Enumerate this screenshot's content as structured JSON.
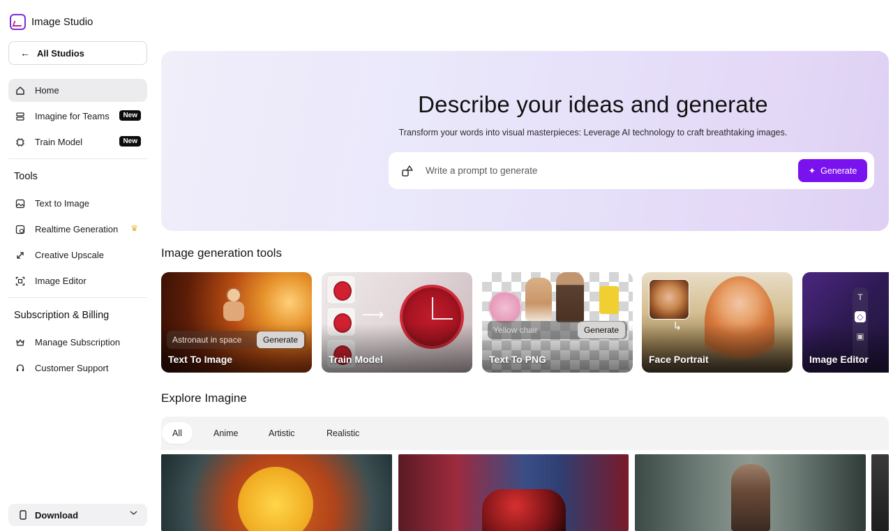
{
  "brand": {
    "name": "Image Studio",
    "icon": "image-studio-logo"
  },
  "sidebar": {
    "all_studios": "All Studios",
    "primary": [
      {
        "label": "Home",
        "icon": "home-icon",
        "active": true
      },
      {
        "label": "Imagine for Teams",
        "icon": "teams-icon",
        "badge": "New"
      },
      {
        "label": "Train Model",
        "icon": "chip-icon",
        "badge": "New"
      }
    ],
    "tools_title": "Tools",
    "tools": [
      {
        "label": "Text to Image",
        "icon": "image-icon"
      },
      {
        "label": "Realtime Generation",
        "icon": "realtime-icon",
        "premium_icon": "crown-icon"
      },
      {
        "label": "Creative Upscale",
        "icon": "expand-icon"
      },
      {
        "label": "Image Editor",
        "icon": "editor-icon"
      }
    ],
    "billing_title": "Subscription & Billing",
    "billing": [
      {
        "label": "Manage Subscription",
        "icon": "crown-outline-icon"
      },
      {
        "label": "Customer Support",
        "icon": "headset-icon"
      }
    ],
    "download": "Download"
  },
  "hero": {
    "title": "Describe your ideas and generate",
    "subtitle": "Transform your words into visual masterpieces: Leverage AI technology to craft breathtaking images.",
    "prompt_placeholder": "Write a prompt to generate",
    "generate_label": "Generate"
  },
  "tools_section": {
    "title": "Image generation tools",
    "cards": [
      {
        "label": "Text To Image",
        "prompt": "Astronaut in space",
        "button": "Generate"
      },
      {
        "label": "Train Model"
      },
      {
        "label": "Text To PNG",
        "prompt": "Yellow chair",
        "button": "Generate"
      },
      {
        "label": "Face Portrait"
      },
      {
        "label": "Image Editor"
      }
    ]
  },
  "explore": {
    "title": "Explore Imagine",
    "filters": [
      "All",
      "Anime",
      "Artistic",
      "Realistic"
    ],
    "active_filter": "All"
  },
  "colors": {
    "accent": "#7a12f0",
    "badge_bg": "#0c0c0c",
    "active_nav": "#ececee"
  }
}
